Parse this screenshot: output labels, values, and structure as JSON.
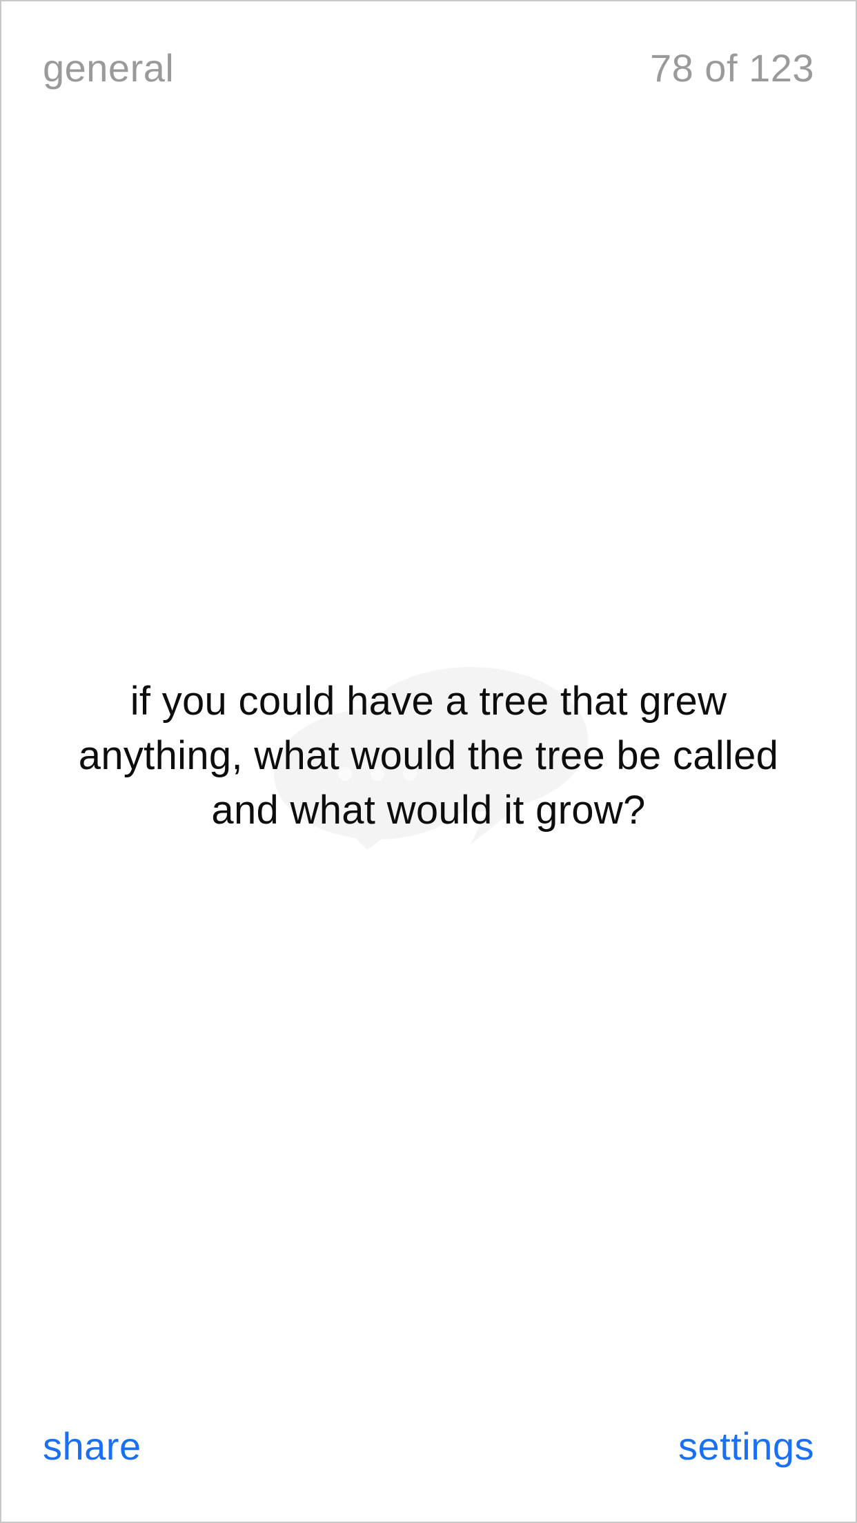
{
  "header": {
    "category": "general",
    "counter": "78 of 123"
  },
  "card": {
    "question": "if you could have a tree that grew anything, what would the tree be called and what would it grow?",
    "watermark_icon": "speech-bubbles-icon"
  },
  "footer": {
    "share_label": "share",
    "settings_label": "settings"
  },
  "colors": {
    "background": "#ffffff",
    "muted_text": "#9a9a9a",
    "question_text": "#0d0d0d",
    "link": "#1a6ff2",
    "watermark": "#f4f4f4"
  }
}
